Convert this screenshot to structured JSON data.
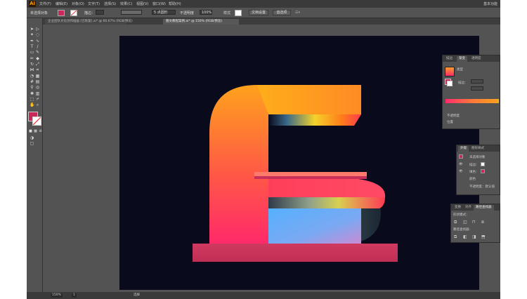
{
  "app": {
    "logo": "Ai",
    "workspace": "基本功能"
  },
  "menu": [
    "文件(F)",
    "编辑(E)",
    "对象(O)",
    "文字(T)",
    "选择(S)",
    "效果(C)",
    "视图(V)",
    "窗口(W)",
    "帮助(H)"
  ],
  "control_bar": {
    "selection_label": "未选择对象",
    "stroke_label": "描边：",
    "brush_field": "5 点圆形",
    "opacity_label": "不透明度",
    "opacity_value": "100%",
    "style_label": "样式",
    "doc_setup_button": "文档设置",
    "prefs_button": "首选项"
  },
  "doc_tabs": [
    "企业团队文化创作插画 [已恢复].ai* @ 66.67% (RGB/预览)",
    "图文教程案例.ai* @ 150% (RGB/预览)"
  ],
  "colors": {
    "fill": "#c8285a",
    "artboard": "#0a0a1d",
    "letter_top": "#ffa21c",
    "letter_bottom": "#ff2a6a",
    "base": "#c9355a",
    "inner_block_top": "#56b0ff",
    "inner_block_bottom": "#c98bd6",
    "curve": "#2b3d45"
  },
  "color_panel": {
    "tabs": [
      "描边",
      "渐变",
      "透明度"
    ],
    "type_label": "类型",
    "stroke_label": "描边：",
    "opacity_label": "不透明度",
    "position_label": "位置"
  },
  "appearance_panel": {
    "tabs": [
      "外观",
      "图形样式"
    ],
    "rows": [
      {
        "label": "未选择对象"
      },
      {
        "label": "描边："
      },
      {
        "label": "填色："
      },
      {
        "label": "颜色"
      },
      {
        "label": "不透明度：默认值"
      }
    ]
  },
  "pathfinder_panel": {
    "tabs": [
      "变换",
      "对齐",
      "路径查找器"
    ],
    "shape_modes_label": "形状模式：",
    "pathfinders_label": "路径查找器："
  },
  "status_bar": {
    "zoom": "150%",
    "artboard_num": "1",
    "tool_name": "选择"
  }
}
